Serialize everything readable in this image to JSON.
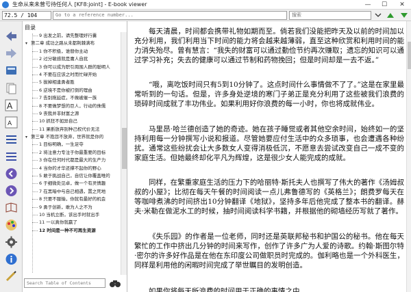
{
  "window": {
    "title": "生命从来未曾亏待任何人 [KF8:joint] - E-book viewer",
    "minimize": "—",
    "maximize": "☐",
    "close": "✕"
  },
  "toolbar": {
    "page_value": "72.5 / 104",
    "go_ref_placeholder": "Go to a reference number...",
    "search_placeholder": "搜索"
  },
  "toc": {
    "header": "目录",
    "search_placeholder": "Search Table of Contents",
    "items": [
      {
        "kind": "section",
        "text": "9  出发之前，请先整理好行囊"
      },
      {
        "kind": "chapter",
        "text": "第二章  成功之路从未都荆棘满布"
      },
      {
        "kind": "section",
        "text": "1  你不积极，谁替你主动"
      },
      {
        "kind": "section",
        "text": "2  过分敏感就是庸人自扰"
      },
      {
        "kind": "section",
        "text": "3  你可以成为职引周围人群的聪明人"
      },
      {
        "kind": "section",
        "text": "4  不要在应该之时而忙碌开始"
      },
      {
        "kind": "section",
        "text": "5  拔掉相逢勇者胜"
      },
      {
        "kind": "section",
        "text": "6  逆境不是你被打倒的理由"
      },
      {
        "kind": "section",
        "text": "7  告别拖延症，不做被催一族"
      },
      {
        "kind": "section",
        "text": "8  不要做梦想的巨人，行动的侏儒"
      },
      {
        "kind": "section",
        "text": "9  丧我并非财富之源"
      },
      {
        "kind": "section",
        "text": "10  抓狂不如异自己"
      },
      {
        "kind": "section",
        "text": "11  果断放弃别种己权代价无法"
      },
      {
        "kind": "chapter",
        "text": "第三章  不抱怨不放弃，世界就是你的"
      },
      {
        "kind": "section",
        "text": "1  目标明确，一生足夺"
      },
      {
        "kind": "section",
        "text": "2  将注意力专注于你最重要的目标"
      },
      {
        "kind": "section",
        "text": "3  你在任何时代都是最大的生产力"
      },
      {
        "kind": "section",
        "text": "4  当你的才华还撑不起你的野心"
      },
      {
        "kind": "section",
        "text": "5  敢于挑战自己，自信让你覆盖唯的"
      },
      {
        "kind": "section",
        "text": "6  于细微处见卓，做一个有灵情趣"
      },
      {
        "kind": "section",
        "text": "7  在黑暗中与自己相遇，置之死地"
      },
      {
        "kind": "section",
        "text": "8  只要不服输，你就有最好的机会"
      },
      {
        "kind": "section",
        "text": "9  勇于创新，敢为人之不为"
      },
      {
        "kind": "section",
        "text": "10  当机立断，该出手时就出手"
      },
      {
        "kind": "section",
        "text": "11  一以真你就赢了"
      },
      {
        "kind": "section",
        "text": "12  时间是一种不可再生资源",
        "current": true
      }
    ]
  },
  "content": {
    "paragraphs": [
      "每天清晨，时间都会携带礼物如期而至。倘若我们没能把昨天及以前的时间加以充分利用，我们利用当下时间的能力将会越来越薄弱，直至这种欣赏和利用时间的能力消失殆尽。曾有慧言：“我失的财富可以通过勤俭节约再次赚取；遗忘的知识可以通过学习补充；失去的健康可以通过节制和药物挽回；但是时间却是一去不返。”",
      "“哦，离吃饭时间只有5到10分钟了。这点时间什么事情做不了了。”这是在家里最常听到的一句话。但是，许多身处逆境的寒门子弟正是充分利用了这些被我们浪费的琐碎时间成就了丰功伟业。如果利用好你浪费的每一小时，你也将成就伟业。",
      "马里昂·哈兰德创造了她的奇迹。她在孩子睡觉或者其他空余时间，始终如一的坚持利用每一分钟撰写小说和报道。尽管她要应付生活中的众多琐事，也会遭遇各种纷扰。通常这些纷扰会让大多数女人变得消极低沉，不愿意去尝试改变自己一成不变的家庭生活。但她最终却化平凡为辉煌，这是很少女人能完成的成就。",
      "同样，在繁重家庭生活的压力下的哈丽特·斯托夫人也撰写了伟大的著作《汤姆叔叔的小屋》；比彻在每天午餐的时间阅读一点儿弗鲁德写的《英格兰》；朗费罗每天在等咖啡煮沸的时间挤出10分钟翻译《地狱》，坚持多年后他完成了整本书的翻译。赫夫·米勒在做泥水工的时候，抽时间阅读科学书籍，并根据他的砌墙经历写就了著作。",
      "《失乐园》的作者是一位老师，同时还是英联邦秘书和护国公的秘书。他在每天繁忙的工作中挤出几分钟的时间来写作，创作了许多广为人爱的诗歌。约翰·斯图尔特·密尔的许多好作品是在他在东印度公司做职员时完成的。伽利略也是一个外科医生，同样是利用他的闲暇时间完成了举世瞩目的发明创造。",
      "如果你将每天所浪费的时间用于正确的事情之中，"
    ]
  }
}
